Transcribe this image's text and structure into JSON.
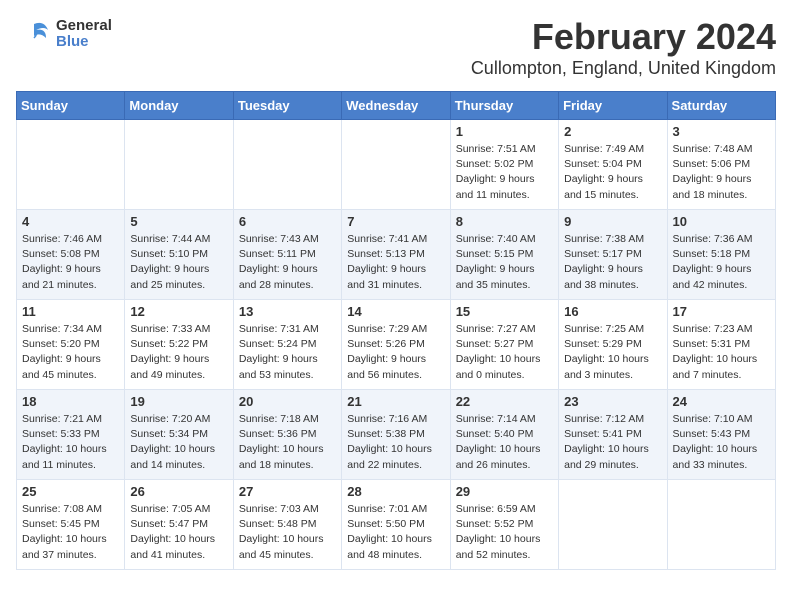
{
  "logo": {
    "general": "General",
    "blue": "Blue"
  },
  "title": "February 2024",
  "subtitle": "Cullompton, England, United Kingdom",
  "days_of_week": [
    "Sunday",
    "Monday",
    "Tuesday",
    "Wednesday",
    "Thursday",
    "Friday",
    "Saturday"
  ],
  "weeks": [
    [
      {
        "day": "",
        "info": ""
      },
      {
        "day": "",
        "info": ""
      },
      {
        "day": "",
        "info": ""
      },
      {
        "day": "",
        "info": ""
      },
      {
        "day": "1",
        "info": "Sunrise: 7:51 AM\nSunset: 5:02 PM\nDaylight: 9 hours\nand 11 minutes."
      },
      {
        "day": "2",
        "info": "Sunrise: 7:49 AM\nSunset: 5:04 PM\nDaylight: 9 hours\nand 15 minutes."
      },
      {
        "day": "3",
        "info": "Sunrise: 7:48 AM\nSunset: 5:06 PM\nDaylight: 9 hours\nand 18 minutes."
      }
    ],
    [
      {
        "day": "4",
        "info": "Sunrise: 7:46 AM\nSunset: 5:08 PM\nDaylight: 9 hours\nand 21 minutes."
      },
      {
        "day": "5",
        "info": "Sunrise: 7:44 AM\nSunset: 5:10 PM\nDaylight: 9 hours\nand 25 minutes."
      },
      {
        "day": "6",
        "info": "Sunrise: 7:43 AM\nSunset: 5:11 PM\nDaylight: 9 hours\nand 28 minutes."
      },
      {
        "day": "7",
        "info": "Sunrise: 7:41 AM\nSunset: 5:13 PM\nDaylight: 9 hours\nand 31 minutes."
      },
      {
        "day": "8",
        "info": "Sunrise: 7:40 AM\nSunset: 5:15 PM\nDaylight: 9 hours\nand 35 minutes."
      },
      {
        "day": "9",
        "info": "Sunrise: 7:38 AM\nSunset: 5:17 PM\nDaylight: 9 hours\nand 38 minutes."
      },
      {
        "day": "10",
        "info": "Sunrise: 7:36 AM\nSunset: 5:18 PM\nDaylight: 9 hours\nand 42 minutes."
      }
    ],
    [
      {
        "day": "11",
        "info": "Sunrise: 7:34 AM\nSunset: 5:20 PM\nDaylight: 9 hours\nand 45 minutes."
      },
      {
        "day": "12",
        "info": "Sunrise: 7:33 AM\nSunset: 5:22 PM\nDaylight: 9 hours\nand 49 minutes."
      },
      {
        "day": "13",
        "info": "Sunrise: 7:31 AM\nSunset: 5:24 PM\nDaylight: 9 hours\nand 53 minutes."
      },
      {
        "day": "14",
        "info": "Sunrise: 7:29 AM\nSunset: 5:26 PM\nDaylight: 9 hours\nand 56 minutes."
      },
      {
        "day": "15",
        "info": "Sunrise: 7:27 AM\nSunset: 5:27 PM\nDaylight: 10 hours\nand 0 minutes."
      },
      {
        "day": "16",
        "info": "Sunrise: 7:25 AM\nSunset: 5:29 PM\nDaylight: 10 hours\nand 3 minutes."
      },
      {
        "day": "17",
        "info": "Sunrise: 7:23 AM\nSunset: 5:31 PM\nDaylight: 10 hours\nand 7 minutes."
      }
    ],
    [
      {
        "day": "18",
        "info": "Sunrise: 7:21 AM\nSunset: 5:33 PM\nDaylight: 10 hours\nand 11 minutes."
      },
      {
        "day": "19",
        "info": "Sunrise: 7:20 AM\nSunset: 5:34 PM\nDaylight: 10 hours\nand 14 minutes."
      },
      {
        "day": "20",
        "info": "Sunrise: 7:18 AM\nSunset: 5:36 PM\nDaylight: 10 hours\nand 18 minutes."
      },
      {
        "day": "21",
        "info": "Sunrise: 7:16 AM\nSunset: 5:38 PM\nDaylight: 10 hours\nand 22 minutes."
      },
      {
        "day": "22",
        "info": "Sunrise: 7:14 AM\nSunset: 5:40 PM\nDaylight: 10 hours\nand 26 minutes."
      },
      {
        "day": "23",
        "info": "Sunrise: 7:12 AM\nSunset: 5:41 PM\nDaylight: 10 hours\nand 29 minutes."
      },
      {
        "day": "24",
        "info": "Sunrise: 7:10 AM\nSunset: 5:43 PM\nDaylight: 10 hours\nand 33 minutes."
      }
    ],
    [
      {
        "day": "25",
        "info": "Sunrise: 7:08 AM\nSunset: 5:45 PM\nDaylight: 10 hours\nand 37 minutes."
      },
      {
        "day": "26",
        "info": "Sunrise: 7:05 AM\nSunset: 5:47 PM\nDaylight: 10 hours\nand 41 minutes."
      },
      {
        "day": "27",
        "info": "Sunrise: 7:03 AM\nSunset: 5:48 PM\nDaylight: 10 hours\nand 45 minutes."
      },
      {
        "day": "28",
        "info": "Sunrise: 7:01 AM\nSunset: 5:50 PM\nDaylight: 10 hours\nand 48 minutes."
      },
      {
        "day": "29",
        "info": "Sunrise: 6:59 AM\nSunset: 5:52 PM\nDaylight: 10 hours\nand 52 minutes."
      },
      {
        "day": "",
        "info": ""
      },
      {
        "day": "",
        "info": ""
      }
    ]
  ]
}
